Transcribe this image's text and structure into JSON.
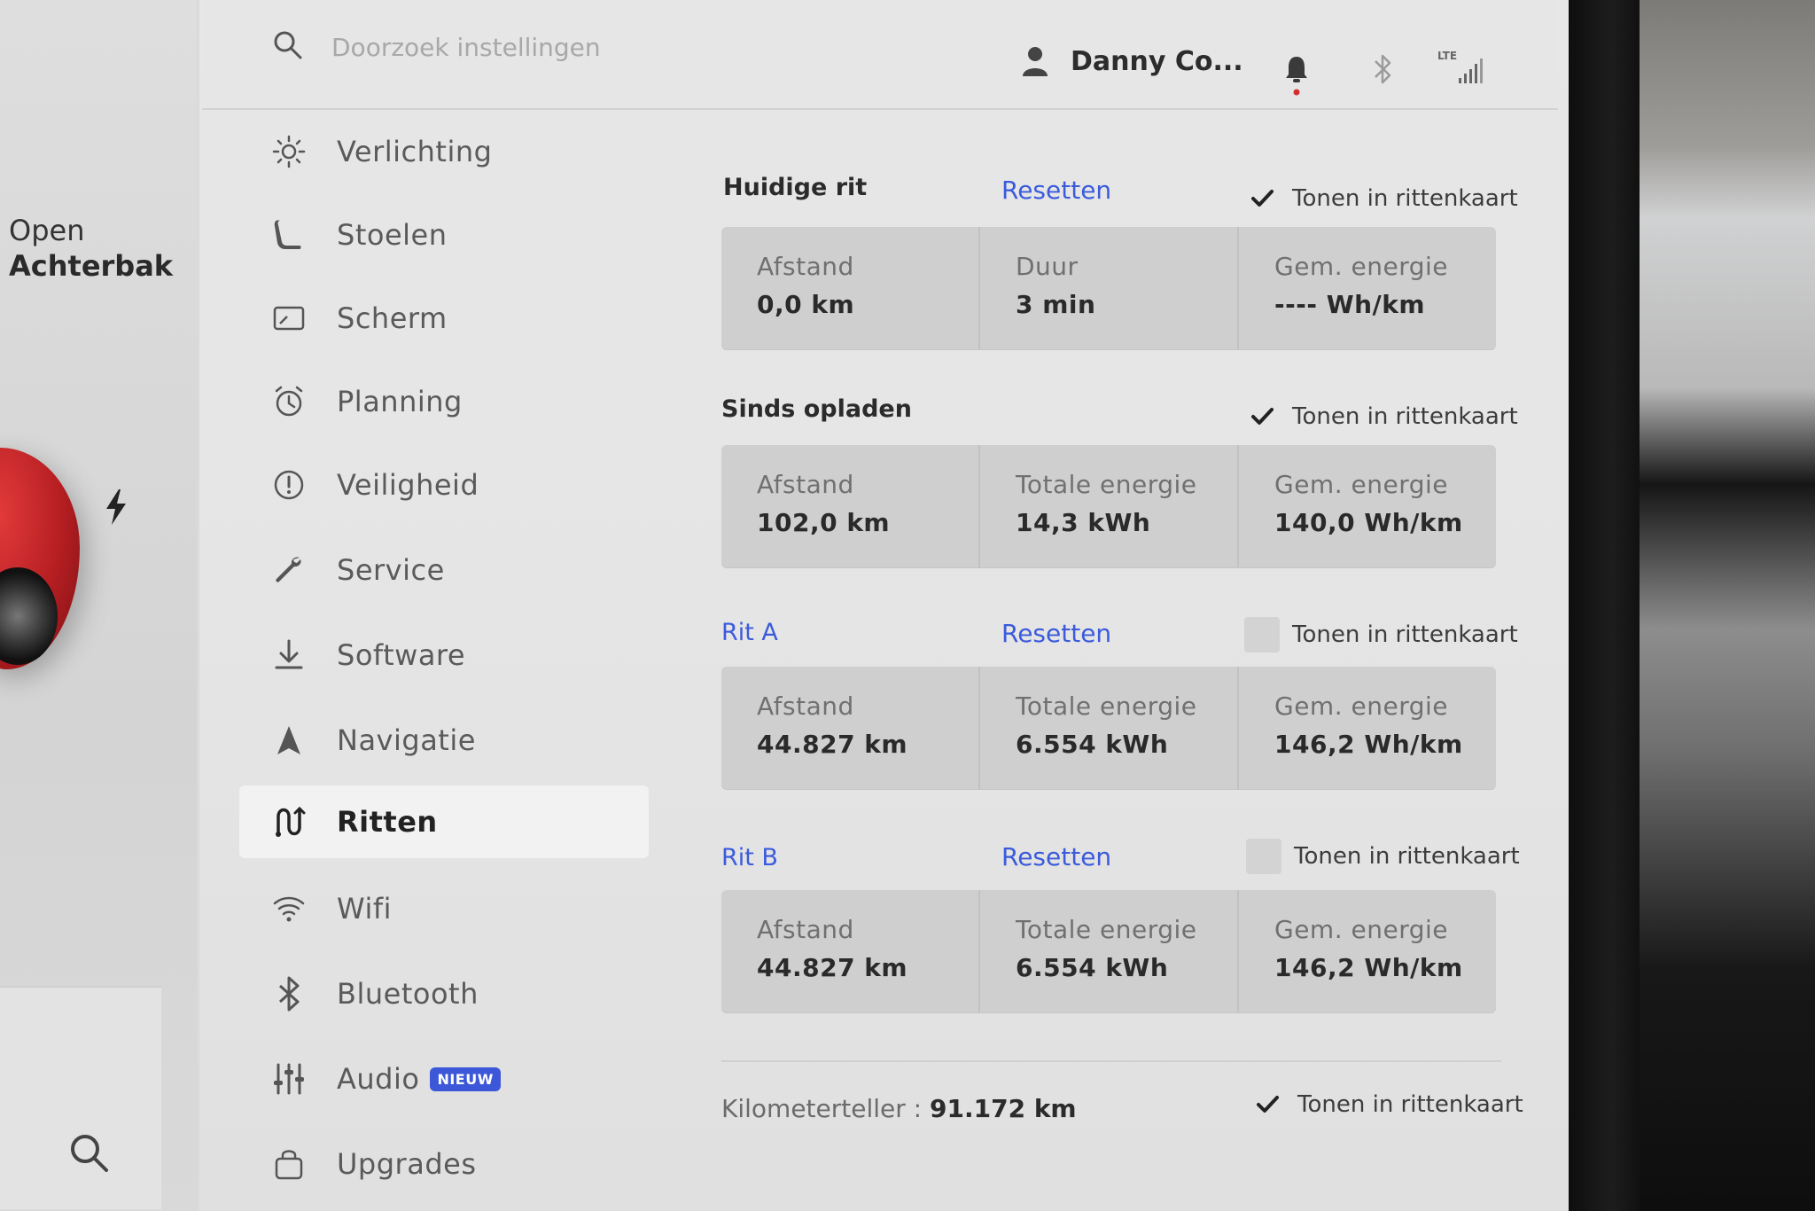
{
  "search": {
    "placeholder": "Doorzoek instellingen"
  },
  "header": {
    "user_name": "Danny Co...",
    "signal_label": "LTE"
  },
  "left_panel": {
    "trunk_line1": "Open",
    "trunk_line2": "Achterbak"
  },
  "sidebar": {
    "items": [
      {
        "label": "Verlichting",
        "icon": "light-icon"
      },
      {
        "label": "Stoelen",
        "icon": "seat-icon"
      },
      {
        "label": "Scherm",
        "icon": "display-icon"
      },
      {
        "label": "Planning",
        "icon": "clock-icon"
      },
      {
        "label": "Veiligheid",
        "icon": "safety-icon"
      },
      {
        "label": "Service",
        "icon": "wrench-icon"
      },
      {
        "label": "Software",
        "icon": "download-icon"
      },
      {
        "label": "Navigatie",
        "icon": "navigation-icon"
      },
      {
        "label": "Ritten",
        "icon": "trips-icon",
        "active": true
      },
      {
        "label": "Wifi",
        "icon": "wifi-icon"
      },
      {
        "label": "Bluetooth",
        "icon": "bluetooth-icon"
      },
      {
        "label": "Audio",
        "icon": "audio-icon",
        "badge": "NIEUW"
      },
      {
        "label": "Upgrades",
        "icon": "bag-icon"
      }
    ]
  },
  "trips": {
    "show_label": "Tonen in rittenkaart",
    "reset_label": "Resetten",
    "current": {
      "title": "Huidige rit",
      "show": true,
      "stats": [
        {
          "label": "Afstand",
          "value": "0,0  km"
        },
        {
          "label": "Duur",
          "value": "3  min"
        },
        {
          "label": "Gem. energie",
          "value": "----  Wh/km"
        }
      ]
    },
    "since_charge": {
      "title": "Sinds opladen",
      "show": true,
      "stats": [
        {
          "label": "Afstand",
          "value": "102,0  km"
        },
        {
          "label": "Totale energie",
          "value": "14,3  kWh"
        },
        {
          "label": "Gem. energie",
          "value": "140,0  Wh/km"
        }
      ]
    },
    "trip_a": {
      "title": "Rit A",
      "show": false,
      "stats": [
        {
          "label": "Afstand",
          "value": "44.827  km"
        },
        {
          "label": "Totale energie",
          "value": "6.554  kWh"
        },
        {
          "label": "Gem. energie",
          "value": "146,2  Wh/km"
        }
      ]
    },
    "trip_b": {
      "title": "Rit B",
      "show": false,
      "stats": [
        {
          "label": "Afstand",
          "value": "44.827  km"
        },
        {
          "label": "Totale energie",
          "value": "6.554  kWh"
        },
        {
          "label": "Gem. energie",
          "value": "146,2  Wh/km"
        }
      ]
    },
    "odometer": {
      "label": "Kilometerteller  :  ",
      "value": "91.172  km",
      "show": true
    }
  },
  "colors": {
    "accent": "#3b5bdb",
    "badge": "#3c57d8",
    "car": "#c0262c"
  }
}
